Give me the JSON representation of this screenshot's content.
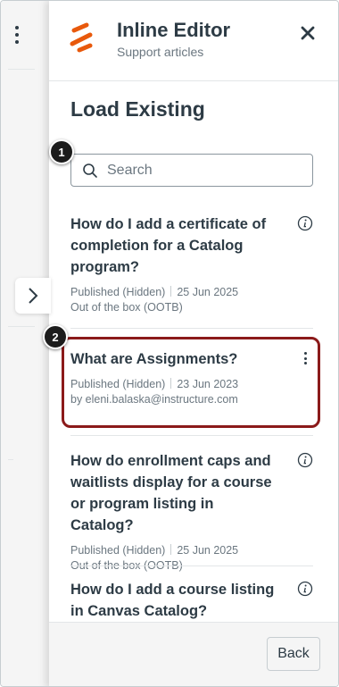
{
  "tray": {
    "title": "Inline Editor",
    "subtitle": "Support articles",
    "section_title": "Load Existing"
  },
  "search": {
    "placeholder": "Search",
    "value": ""
  },
  "callouts": [
    "1",
    "2"
  ],
  "articles": [
    {
      "title": "How do I add a certificate of completion for a Catalog program?",
      "status": "Published (Hidden)",
      "date": "25 Jun 2025",
      "author": "Out of the box (OOTB)",
      "action_icon": "info-icon"
    },
    {
      "title": "What are Assignments?",
      "status": "Published (Hidden)",
      "date": "23 Jun 2023",
      "author": "by eleni.balaska@instructure.com",
      "action_icon": "more-options-icon"
    },
    {
      "title": "How do enrollment caps and waitlists display for a course or program listing in Catalog?",
      "status": "Published (Hidden)",
      "date": "25 Jun 2025",
      "author": "Out of the box (OOTB)",
      "action_icon": "info-icon"
    },
    {
      "title": "How do I add a course listing in Canvas Catalog?",
      "action_icon": "info-icon"
    }
  ],
  "footer": {
    "back_label": "Back"
  },
  "colors": {
    "brand_orange": "#e8590c",
    "highlight_border": "#8b1a1a",
    "text_primary": "#2d3b45",
    "text_secondary": "#6b7780"
  }
}
